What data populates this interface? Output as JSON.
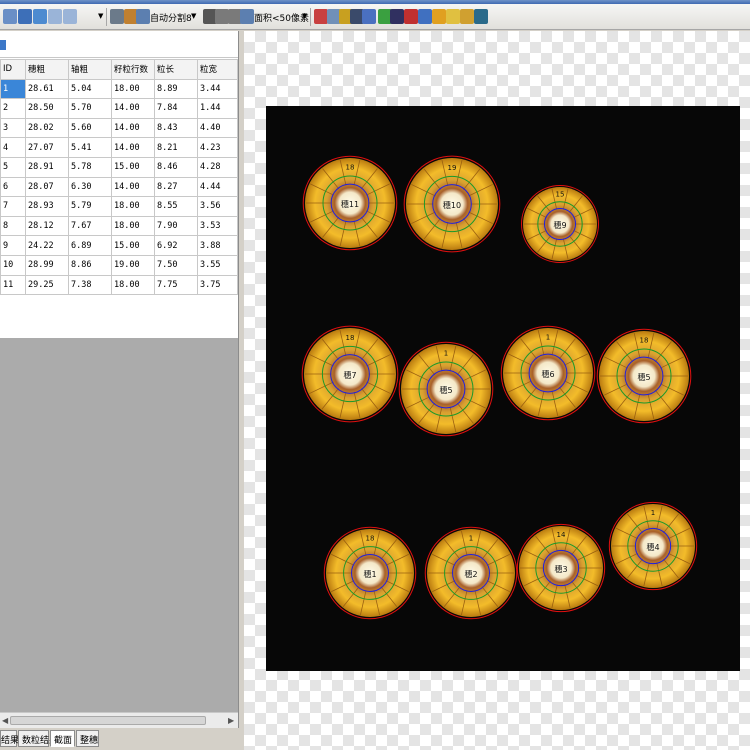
{
  "toolbar": {
    "split_mode_label": "自动分割8",
    "area_filter_label": "面积<50像素"
  },
  "table": {
    "headers": [
      "ID",
      "穗粗",
      "轴粗",
      "籽粒行数",
      "粒长",
      "粒宽"
    ],
    "rows": [
      [
        "1",
        "28.61",
        "5.04",
        "18.00",
        "8.89",
        "3.44"
      ],
      [
        "2",
        "28.50",
        "5.70",
        "14.00",
        "7.84",
        "1.44"
      ],
      [
        "3",
        "28.02",
        "5.60",
        "14.00",
        "8.43",
        "4.40"
      ],
      [
        "4",
        "27.07",
        "5.41",
        "14.00",
        "8.21",
        "4.23"
      ],
      [
        "5",
        "28.91",
        "5.78",
        "15.00",
        "8.46",
        "4.28"
      ],
      [
        "6",
        "28.07",
        "6.30",
        "14.00",
        "8.27",
        "4.44"
      ],
      [
        "7",
        "28.93",
        "5.79",
        "18.00",
        "8.55",
        "3.56"
      ],
      [
        "8",
        "28.12",
        "7.67",
        "18.00",
        "7.90",
        "3.53"
      ],
      [
        "9",
        "24.22",
        "6.89",
        "15.00",
        "6.92",
        "3.88"
      ],
      [
        "10",
        "28.99",
        "8.86",
        "19.00",
        "7.50",
        "3.55"
      ],
      [
        "11",
        "29.25",
        "7.38",
        "18.00",
        "7.75",
        "3.75"
      ]
    ]
  },
  "tabs": [
    "结果",
    "数粒结果",
    "截面",
    "整穗"
  ],
  "active_tab": "截面",
  "ears": [
    {
      "label": "穗11",
      "num": "18"
    },
    {
      "label": "穗10",
      "num": "19"
    },
    {
      "label": "穗9",
      "num": "15"
    },
    {
      "label": "穗7",
      "num": "18"
    },
    {
      "label": "穗5",
      "num": "1"
    },
    {
      "label": "穗6",
      "num": "1"
    },
    {
      "label": "穗5",
      "num": "18"
    },
    {
      "label": "穗1",
      "num": "18"
    },
    {
      "label": "穗2",
      "num": "1"
    },
    {
      "label": "穗3",
      "num": "14"
    },
    {
      "label": "穗4",
      "num": "1"
    }
  ]
}
